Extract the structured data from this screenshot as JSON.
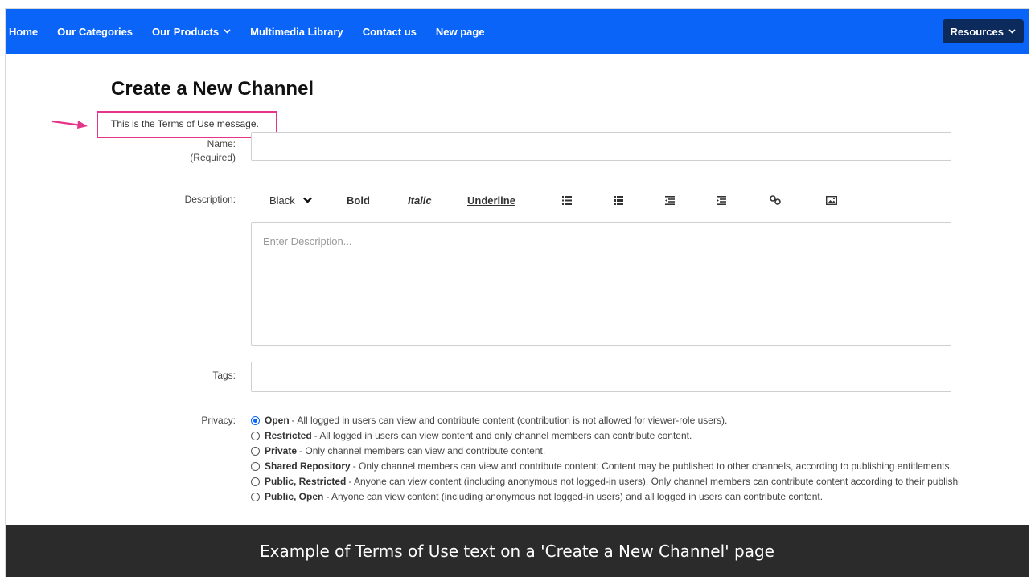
{
  "nav": {
    "items": [
      {
        "label": "Home"
      },
      {
        "label": "Our Categories"
      },
      {
        "label": "Our Products",
        "dropdown": true
      },
      {
        "label": "Multimedia Library"
      },
      {
        "label": "Contact us"
      },
      {
        "label": "New page"
      }
    ],
    "resources_label": "Resources",
    "bar_color": "#0a64f7"
  },
  "page": {
    "title": "Create a New Channel",
    "terms_message": "This is the Terms of Use message."
  },
  "form": {
    "name_label": "Name:",
    "name_required": "(Required)",
    "name_value": "",
    "description_label": "Description:",
    "description_placeholder": "Enter Description...",
    "toolbar": {
      "color": "Black",
      "bold": "Bold",
      "italic": "Italic",
      "underline": "Underline",
      "icons": [
        "unordered-list-icon",
        "ordered-list-icon",
        "outdent-icon",
        "indent-icon",
        "link-icon",
        "image-icon"
      ]
    },
    "tags_label": "Tags:",
    "tags_value": "",
    "privacy_label": "Privacy:",
    "privacy_options": [
      {
        "name": "Open",
        "desc": " - All logged in users can view and contribute content (contribution is not allowed for viewer-role users).",
        "checked": true
      },
      {
        "name": "Restricted",
        "desc": " - All logged in users can view content and only channel members can contribute content.",
        "checked": false
      },
      {
        "name": "Private",
        "desc": " - Only channel members can view and contribute content.",
        "checked": false
      },
      {
        "name": "Shared Repository",
        "desc": " - Only channel members can view and contribute content; Content may be published to other channels, according to publishing entitlements.",
        "checked": false
      },
      {
        "name": "Public, Restricted",
        "desc": " - Anyone can view content (including anonymous not logged-in users). Only channel members can contribute content according to their publishi",
        "checked": false
      },
      {
        "name": "Public, Open",
        "desc": " - Anyone can view content (including anonymous not logged-in users) and all logged in users can contribute content.",
        "checked": false
      }
    ]
  },
  "annotation": {
    "highlight_color": "#e5358a"
  },
  "caption": "Example of Terms of Use text on a 'Create a New Channel' page"
}
